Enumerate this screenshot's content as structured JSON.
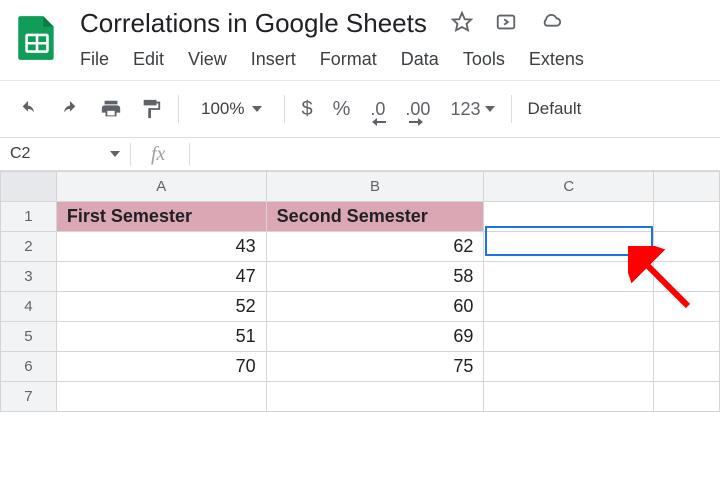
{
  "doc_title": "Correlations in Google Sheets",
  "menu": {
    "file": "File",
    "edit": "Edit",
    "view": "View",
    "insert": "Insert",
    "format": "Format",
    "data": "Data",
    "tools": "Tools",
    "extensions": "Extens"
  },
  "toolbar": {
    "zoom": "100%",
    "dollar": "$",
    "percent": "%",
    "dec_dec": ".0",
    "inc_dec": ".00",
    "num123": "123",
    "font": "Default"
  },
  "name_box": "C2",
  "fx": "fx",
  "columns": [
    "A",
    "B",
    "C"
  ],
  "rows": [
    "1",
    "2",
    "3",
    "4",
    "5",
    "6",
    "7"
  ],
  "headers": {
    "a": "First Semester",
    "b": "Second Semester"
  },
  "cells": {
    "a2": "43",
    "b2": "62",
    "a3": "47",
    "b3": "58",
    "a4": "52",
    "b4": "60",
    "a5": "51",
    "b5": "69",
    "a6": "70",
    "b6": "75"
  }
}
